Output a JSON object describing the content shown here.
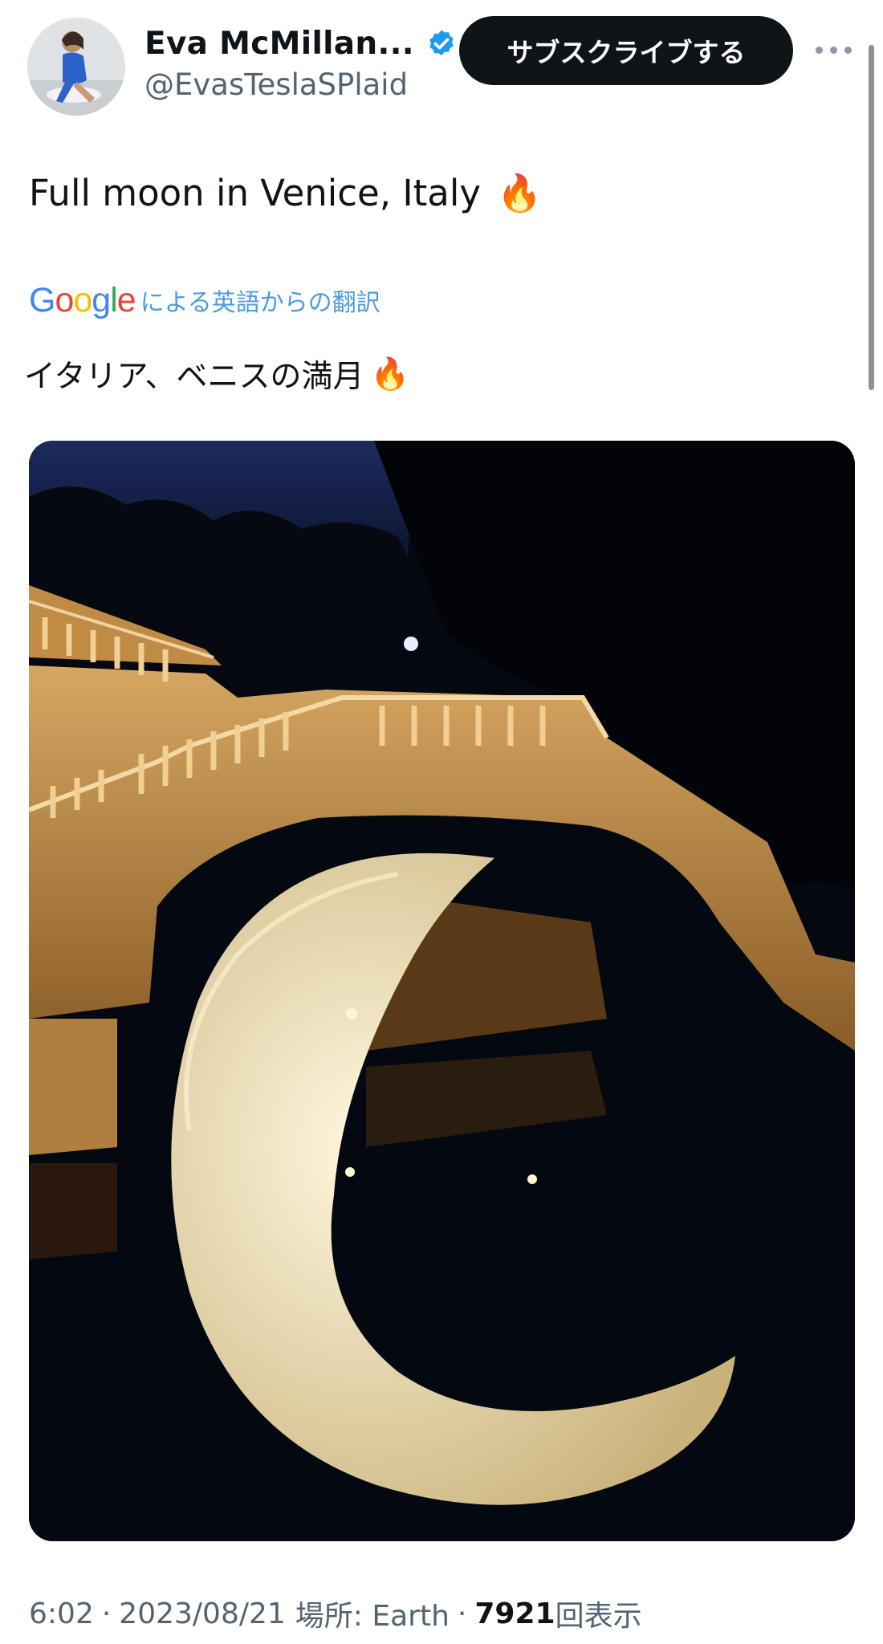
{
  "author": {
    "display_name": "Eva McMillan...",
    "handle": "@EvasTeslaSPlaid",
    "verified": true,
    "avatar_icon": "profile-photo"
  },
  "header": {
    "subscribe_label": "サブスクライブする",
    "more_icon": "more-dots-icon"
  },
  "tweet": {
    "text": "Full moon in Venice, Italy",
    "emoji": "🔥"
  },
  "translation": {
    "provider": "Google",
    "label": "による英語からの翻訳",
    "text": "イタリア、ベニスの満月",
    "emoji": "🔥"
  },
  "media": {
    "icon": "photo-bridge-crescent-moon-reflection"
  },
  "meta": {
    "time": "6:02",
    "separator": "·",
    "date": "2023/08/21",
    "location_label": "場所: Earth",
    "views_count": "7921",
    "views_label": "回表示"
  },
  "colors": {
    "link_blue": "#4c9be0",
    "verified_blue": "#1d9bf0",
    "text_primary": "#0f1419",
    "text_secondary": "#536471"
  }
}
